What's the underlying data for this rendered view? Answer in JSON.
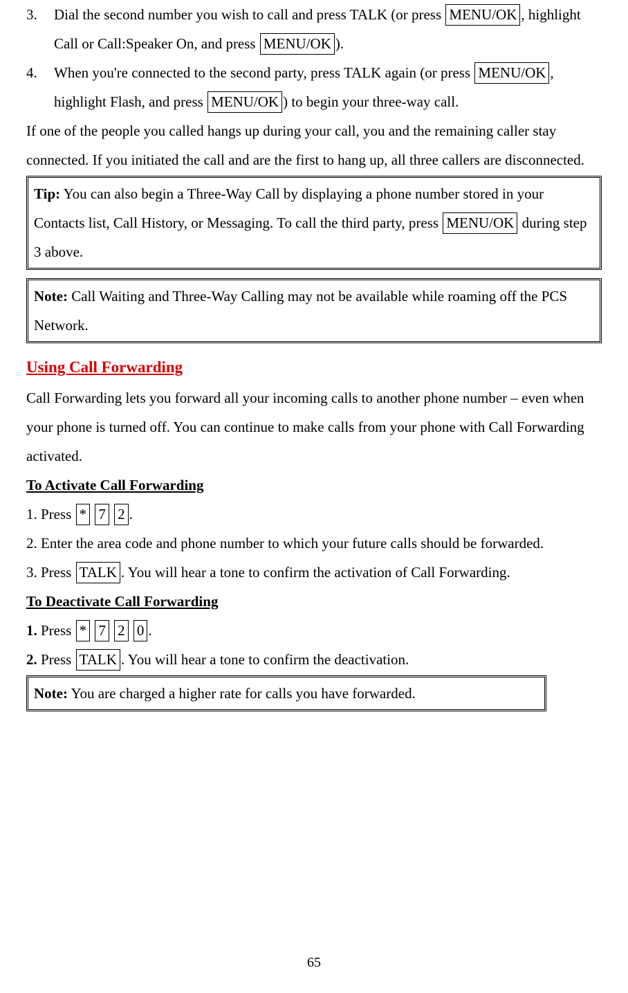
{
  "items": {
    "i3_num": "3.",
    "i3_a": "Dial the second number you wish to call and press TALK (or press ",
    "i3_k1": "MENU/OK",
    "i3_b": ", highlight Call or Call:Speaker On, and press ",
    "i3_k2": "MENU/OK",
    "i3_c": ").",
    "i4_num": "4.",
    "i4_a": "When you're connected to the second party, press TALK again (or press ",
    "i4_k1": "MENU/OK",
    "i4_b": ", highlight Flash, and press ",
    "i4_k2": "MENU/OK",
    "i4_c": ") to begin your three-way call."
  },
  "trail": "If one of the people you called hangs up during your call, you and the remaining caller stay connected. If you initiated the call and are the first to hang up, all three callers are disconnected.",
  "tip": {
    "label": "Tip:",
    "a": " You can also begin a Three-Way Call by displaying a phone number stored in your Contacts list, Call History, or Messaging. To call the third party, press ",
    "k": "MENU/OK",
    "b": " during step 3 above."
  },
  "note1": {
    "label": "Note:",
    "text": " Call Waiting and Three-Way Calling may not be available while roaming off the PCS Network."
  },
  "cf": {
    "heading": "Using Call Forwarding",
    "intro": "Call Forwarding lets you forward all your incoming calls to another phone number – even when your phone is turned off. You can continue to make calls from your phone with Call Forwarding activated.",
    "act_head": "To Activate Call Forwarding",
    "a1_a": "1. Press ",
    "a1_k1": " * ",
    "a1_k2": " 7 ",
    "a1_k3": " 2 ",
    "a1_b": ".",
    "a2": "2. Enter the area code and phone number to which your future calls should be forwarded.",
    "a3_a": "3. Press ",
    "a3_k": "TALK",
    "a3_b": ". You will hear a tone to confirm the activation of Call Forwarding.",
    "deact_head": "To Deactivate Call Forwarding",
    "d1_num": "1.",
    "d1_a": " Press ",
    "d1_k1": " * ",
    "d1_k2": " 7 ",
    "d1_k3": " 2 ",
    "d1_k4": " 0 ",
    "d1_b": ".",
    "d2_num": "2.",
    "d2_a": " Press ",
    "d2_k": "TALK",
    "d2_b": ". You will hear a tone to confirm the deactivation."
  },
  "note2": {
    "label": "Note:",
    "text": " You are charged a higher rate for calls you have forwarded."
  },
  "page_num": "65"
}
